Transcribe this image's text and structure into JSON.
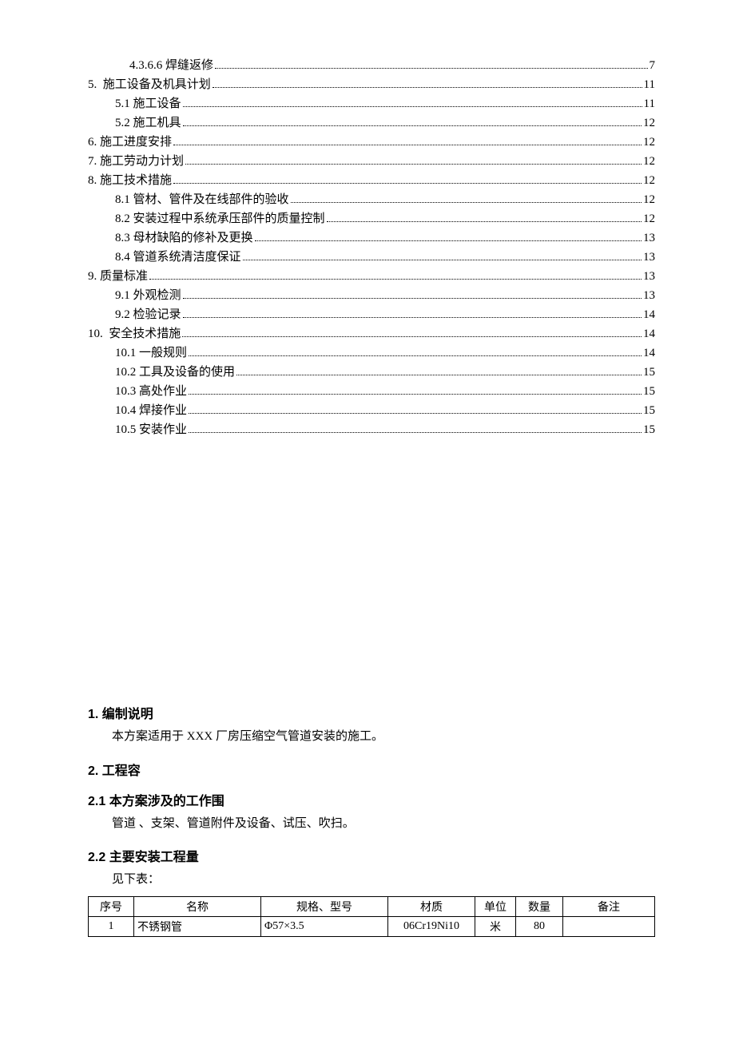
{
  "toc": [
    {
      "indent": 3,
      "label": "4.3.6.6 焊缝返修",
      "page": "7"
    },
    {
      "indent": 1,
      "label": "5.  施工设备及机具计划",
      "page": "11"
    },
    {
      "indent": 2,
      "label": "5.1 施工设备",
      "page": "11"
    },
    {
      "indent": 2,
      "label": "5.2 施工机具",
      "page": "12"
    },
    {
      "indent": 1,
      "label": "6. 施工进度安排",
      "page": "12"
    },
    {
      "indent": 1,
      "label": "7. 施工劳动力计划",
      "page": "12"
    },
    {
      "indent": 1,
      "label": "8. 施工技术措施",
      "page": "12"
    },
    {
      "indent": 2,
      "label": "8.1 管材、管件及在线部件的验收",
      "page": "12"
    },
    {
      "indent": 2,
      "label": "8.2 安装过程中系统承压部件的质量控制",
      "page": "12"
    },
    {
      "indent": 2,
      "label": "8.3 母材缺陷的修补及更换",
      "page": "13"
    },
    {
      "indent": 2,
      "label": "8.4 管道系统清洁度保证",
      "page": "13"
    },
    {
      "indent": 1,
      "label": "9. 质量标准",
      "page": "13"
    },
    {
      "indent": 2,
      "label": "9.1 外观检测",
      "page": "13"
    },
    {
      "indent": 2,
      "label": "9.2 检验记录",
      "page": "14"
    },
    {
      "indent": 1,
      "label": "10.  安全技术措施",
      "page": "14"
    },
    {
      "indent": 2,
      "label": "10.1 一般规则",
      "page": "14"
    },
    {
      "indent": 2,
      "label": "10.2 工具及设备的使用",
      "page": "15"
    },
    {
      "indent": 2,
      "label": "10.3 高处作业",
      "page": "15"
    },
    {
      "indent": 2,
      "label": "10.4 焊接作业",
      "page": "15"
    },
    {
      "indent": 2,
      "label": "10.5 安装作业",
      "page": "15"
    }
  ],
  "sections": {
    "s1_title": "1. 编制说明",
    "s1_body": "本方案适用于 XXX 厂房压缩空气管道安装的施工。",
    "s2_title": "2. 工程容",
    "s2_1_title": "2.1 本方案涉及的工作围",
    "s2_1_body": "管道 、支架、管道附件及设备、试压、吹扫。",
    "s2_2_title": "2.2 主要安装工程量",
    "s2_2_body": "见下表："
  },
  "table": {
    "headers": [
      "序号",
      "名称",
      "规格、型号",
      "材质",
      "单位",
      "数量",
      "备注"
    ],
    "rows": [
      {
        "seq": "1",
        "name": "不锈钢管",
        "spec": "Φ57×3.5",
        "material": "06Cr19Ni10",
        "unit": "米",
        "qty": "80",
        "note": ""
      }
    ]
  }
}
